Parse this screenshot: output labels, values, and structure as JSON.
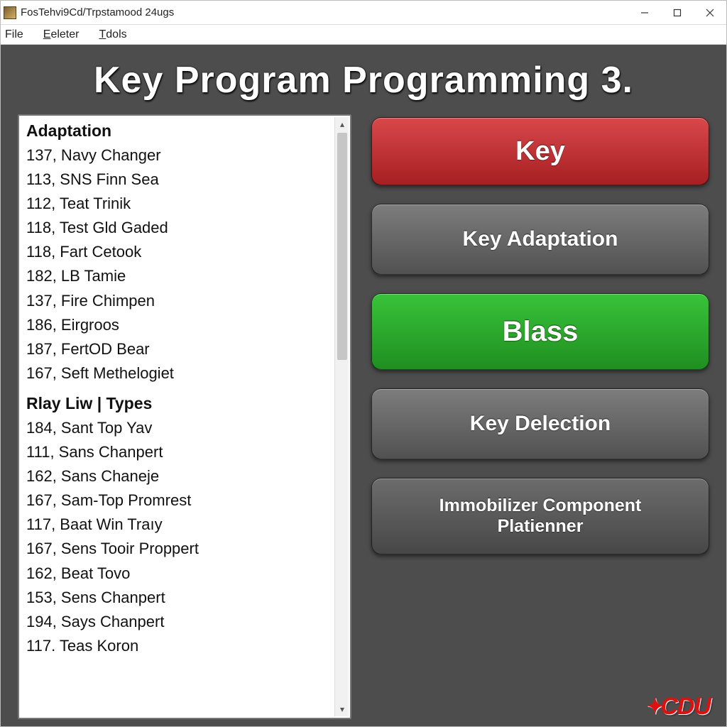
{
  "window": {
    "title": "FosTehvi9Cd/Trpstamood 24ugs"
  },
  "menubar": {
    "file": "File",
    "eeleter": "Eeleter",
    "tdols": "Tdols"
  },
  "banner": "Key  Program  Programming  3.",
  "list": {
    "section1_header": "Adaptation",
    "section1_rows": [
      "137, Navy Changer",
      "113, SNS Finn Sea",
      "112, Teat Trinik",
      "118, Test Gld Gaded",
      "118, Fart Cetook",
      "182, LB Tamie",
      "137, Fire Chimpen",
      "186, Eirgroos",
      "187, FertOD Bear",
      "167, Seft Methelogiet"
    ],
    "section2_header": "Rlay Liw  |  Types",
    "section2_rows": [
      "184, Sant Top Yav",
      "111, Sans Chanpert",
      "162, Sans Chaneje",
      "167, Sam-Top Promrest",
      "117, Baat Win Traıy",
      "167, Sens Tooir Proppert",
      "162, Beat Tovo",
      "153, Sens Chanpert",
      "194, Says Chanpert",
      "117. Teas Koron"
    ]
  },
  "buttons": {
    "b1": "Key",
    "b2": "Key Adaptation",
    "b3": "Blass",
    "b4": "Key Delection",
    "b5a": "Immobilizer Component",
    "b5b": "Platienner"
  },
  "logo": "CDU"
}
